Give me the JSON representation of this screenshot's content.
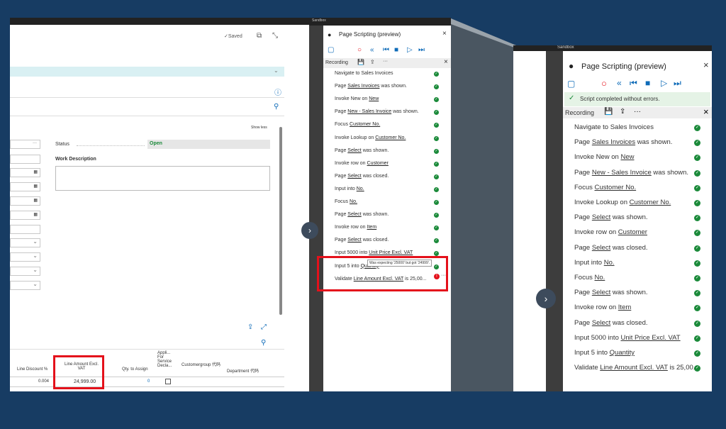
{
  "colors": {
    "background": "#173c63",
    "accent": "#0e6bb8",
    "success": "#1b8a3a",
    "highlight": "#e4111b"
  },
  "left": {
    "saved_label": "✓Saved",
    "show_less": "Show less",
    "status_label": "Status",
    "status_value": "Open",
    "work_description_label": "Work Description",
    "table_headers": [
      "Line Discount %",
      "Line Amount Excl. VAT",
      "Qty. to Assign",
      "Appli... For Service Decla...",
      "Customergroup 代码",
      "Department 代码"
    ],
    "row": {
      "line_discount": "0.004",
      "line_amount": "24,999.00",
      "qty_to_assign": "0"
    }
  },
  "sandbox_label": "Sandbox",
  "panel": {
    "title": "Page Scripting (preview)",
    "recording_label": "Recording",
    "completed": "Script completed without errors.",
    "tooltip": "Was expecting '25000' but got '24999'."
  },
  "steps": [
    {
      "pre": "Navigate to Sales Invoices",
      "link": "",
      "post": ""
    },
    {
      "pre": "Page ",
      "link": "Sales Invoices",
      "post": " was shown."
    },
    {
      "pre": "Invoke New on ",
      "link": "New",
      "post": ""
    },
    {
      "pre": "Page ",
      "link": "New - Sales Invoice",
      "post": " was shown."
    },
    {
      "pre": "Focus ",
      "link": "Customer No.",
      "post": ""
    },
    {
      "pre": "Invoke Lookup on ",
      "link": "Customer No.",
      "post": ""
    },
    {
      "pre": "Page ",
      "link": "Select",
      "post": " was shown."
    },
    {
      "pre": "Invoke row on ",
      "link": "Customer",
      "post": ""
    },
    {
      "pre": "Page ",
      "link": "Select",
      "post": " was closed."
    },
    {
      "pre": "Input into ",
      "link": "No.",
      "post": ""
    },
    {
      "pre": "Focus ",
      "link": "No.",
      "post": ""
    },
    {
      "pre": "Page ",
      "link": "Select",
      "post": " was shown."
    },
    {
      "pre": "Invoke row on ",
      "link": "Item",
      "post": ""
    },
    {
      "pre": "Page ",
      "link": "Select",
      "post": " was closed."
    },
    {
      "pre": "Input 5000 into ",
      "link": "Unit Price Excl. VAT",
      "post": ""
    },
    {
      "pre": "Input 5 into ",
      "link": "Quantity",
      "post": ""
    },
    {
      "pre": "Validate ",
      "link": "Line Amount Excl. VAT",
      "post": " is 25,00..."
    }
  ]
}
